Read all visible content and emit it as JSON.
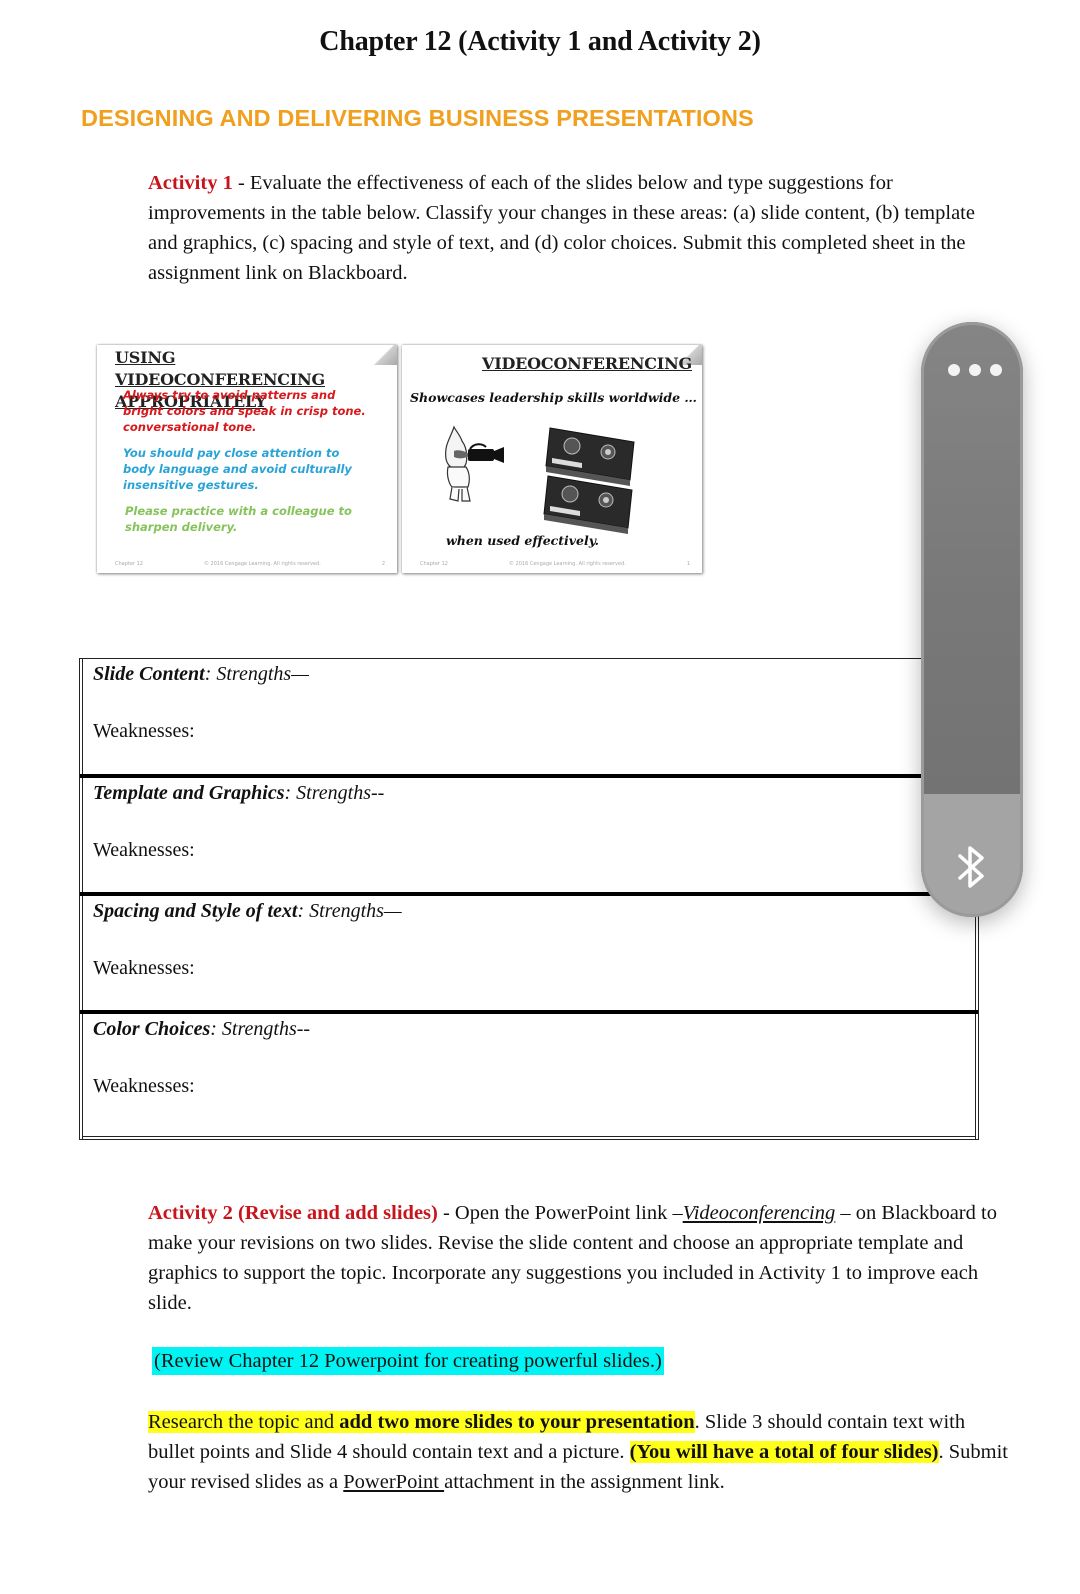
{
  "document": {
    "title": "Chapter 12 (Activity 1 and Activity 2)",
    "subtitle": "DESIGNING AND DELIVERING BUSINESS PRESENTATIONS",
    "accent_color": "#f0a01e",
    "activity1": {
      "label": "Activity 1",
      "text": " - Evaluate the effectiveness of each of the slides below and type suggestions for improvements in the table below. Classify your changes in these areas: (a) slide content, (b) template and graphics, (c) spacing and style of text, and (d) color choices. Submit this completed sheet in the assignment link on Blackboard."
    },
    "slides": [
      {
        "title": "USING VIDEOCONFERENCING APPROPRIATELY",
        "points": [
          {
            "text": "Always try to avoid patterns and bright colors and speak in crisp tone. conversational tone.",
            "color": "#d7191c"
          },
          {
            "text": "You should pay close attention to body language and avoid culturally insensitive gestures.",
            "color": "#2aa3d6"
          },
          {
            "text": "Please practice with a colleague to sharpen delivery.",
            "color": "#86c35a"
          }
        ],
        "footer": {
          "left": "Chapter 12",
          "center": "© 2016 Cengage Learning. All rights reserved.",
          "right": "2"
        }
      },
      {
        "title": "VIDEOCONFERENCING",
        "tagline": "Showcases leadership skills worldwide …",
        "caption": "when used effectively.",
        "images": [
          "cartoon-with-video-camera",
          "vhs-tapes"
        ],
        "footer": {
          "left": "Chapter 12",
          "center": "© 2016 Cengage Learning. All rights reserved.",
          "right": "1"
        }
      }
    ],
    "table": {
      "rows": [
        {
          "category": "Slide Content",
          "strengths": ": Strengths—",
          "weaknesses": "Weaknesses:"
        },
        {
          "category": "Template and Graphics",
          "strengths": ": Strengths--",
          "weaknesses": "Weaknesses:"
        },
        {
          "category": "Spacing and Style of text",
          "strengths": ": Strengths—",
          "weaknesses": "Weaknesses:"
        },
        {
          "category": "Color Choices",
          "strengths": ": Strengths--",
          "weaknesses": "Weaknesses:"
        }
      ]
    },
    "activity2": {
      "label": "Activity 2 (Revise and add slides)",
      "text_before_link": " - Open the PowerPoint link –",
      "link": "Videoconferencing",
      "text_after_link": " – on Blackboard to make your revisions on two slides. Revise the slide content and choose an appropriate template and graphics to support the topic. Incorporate any suggestions you included in Activity 1 to improve each slide.",
      "review_note": "(Review Chapter 12 Powerpoint for creating powerful slides.)",
      "review_highlight": "#00f4f4",
      "research": {
        "hl_plain": "Research the topic and ",
        "hl_bold": "add two more slides to your presentation",
        "plain1": ". Slide 3 should contain text with bullet points and Slide 4 should contain text and a picture. ",
        "hl_bold2": "(You will have a total of four slides)",
        "plain2": ". Submit your revised slides as a ",
        "link": "PowerPoint ",
        "plain3": "attachment in the assignment link.",
        "highlight_color": "#ffff1a"
      }
    }
  },
  "overlay_widget": {
    "menu_icon": "more-dots-icon",
    "bottom_icon": "bluetooth-icon"
  }
}
